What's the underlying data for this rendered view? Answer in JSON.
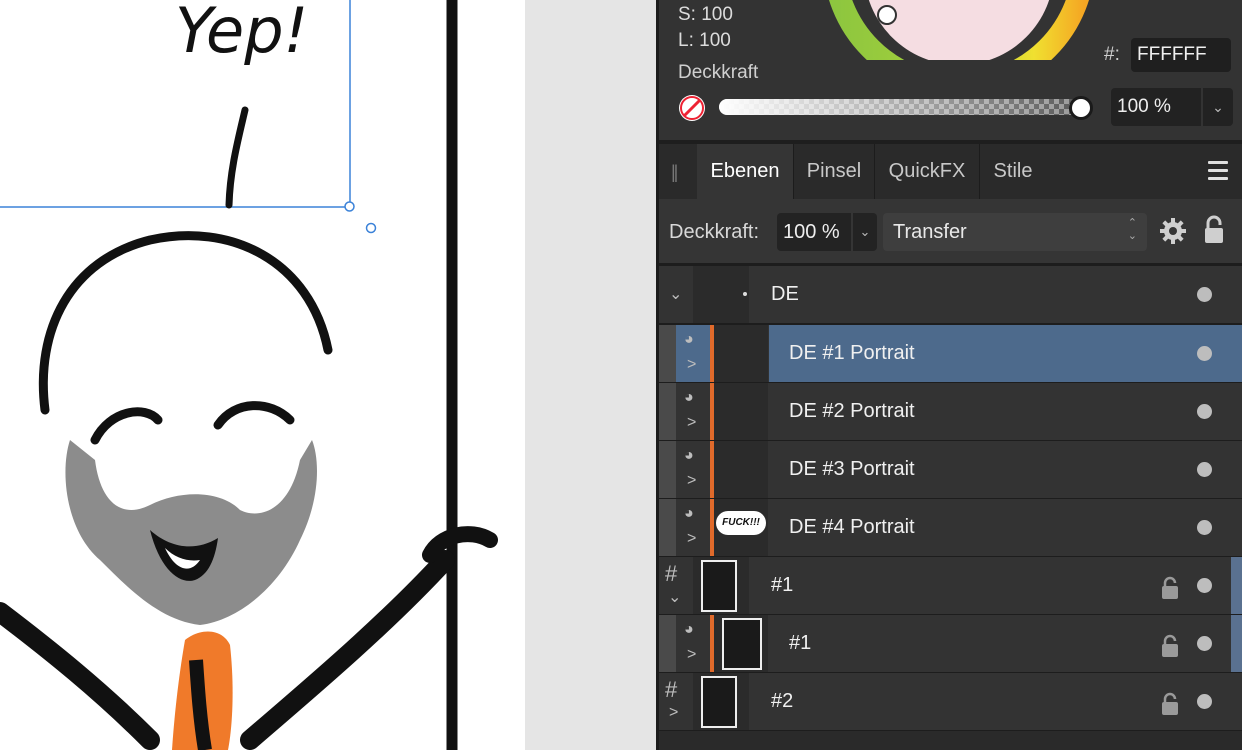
{
  "canvas": {
    "speech_text": "Yep!"
  },
  "color_panel": {
    "s_value": "S: 100",
    "l_value": "L: 100",
    "opacity_label": "Deckkraft",
    "hex_label": "#:",
    "hex_value": "FFFFFF",
    "opacity_value": "100 %",
    "opacity_fraction": 1.0
  },
  "tabs": {
    "items": [
      {
        "label": "Ebenen",
        "active": true
      },
      {
        "label": "Pinsel",
        "active": false
      },
      {
        "label": "QuickFX",
        "active": false
      },
      {
        "label": "Stile",
        "active": false
      }
    ]
  },
  "layer_toolbar": {
    "opacity_label": "Deckkraft:",
    "opacity_value": "100 %",
    "blend_mode": "Transfer"
  },
  "layers": [
    {
      "name": "DE",
      "selected": false
    },
    {
      "name": "DE #1 Portrait",
      "selected": true
    },
    {
      "name": "DE #2 Portrait",
      "selected": false
    },
    {
      "name": "DE #3 Portrait",
      "selected": false
    },
    {
      "name": "DE #4 Portrait",
      "selected": false,
      "thumb_text": "FUCK!!!"
    },
    {
      "name": "#1",
      "selected": false,
      "locked": true
    },
    {
      "name": "#1",
      "selected": false,
      "locked": true
    },
    {
      "name": "#2",
      "selected": false,
      "locked": true
    }
  ],
  "colors": {
    "selection_blue": "#4d6a8c",
    "accent_orange": "#e06a2b",
    "panel_bg": "#333333"
  }
}
